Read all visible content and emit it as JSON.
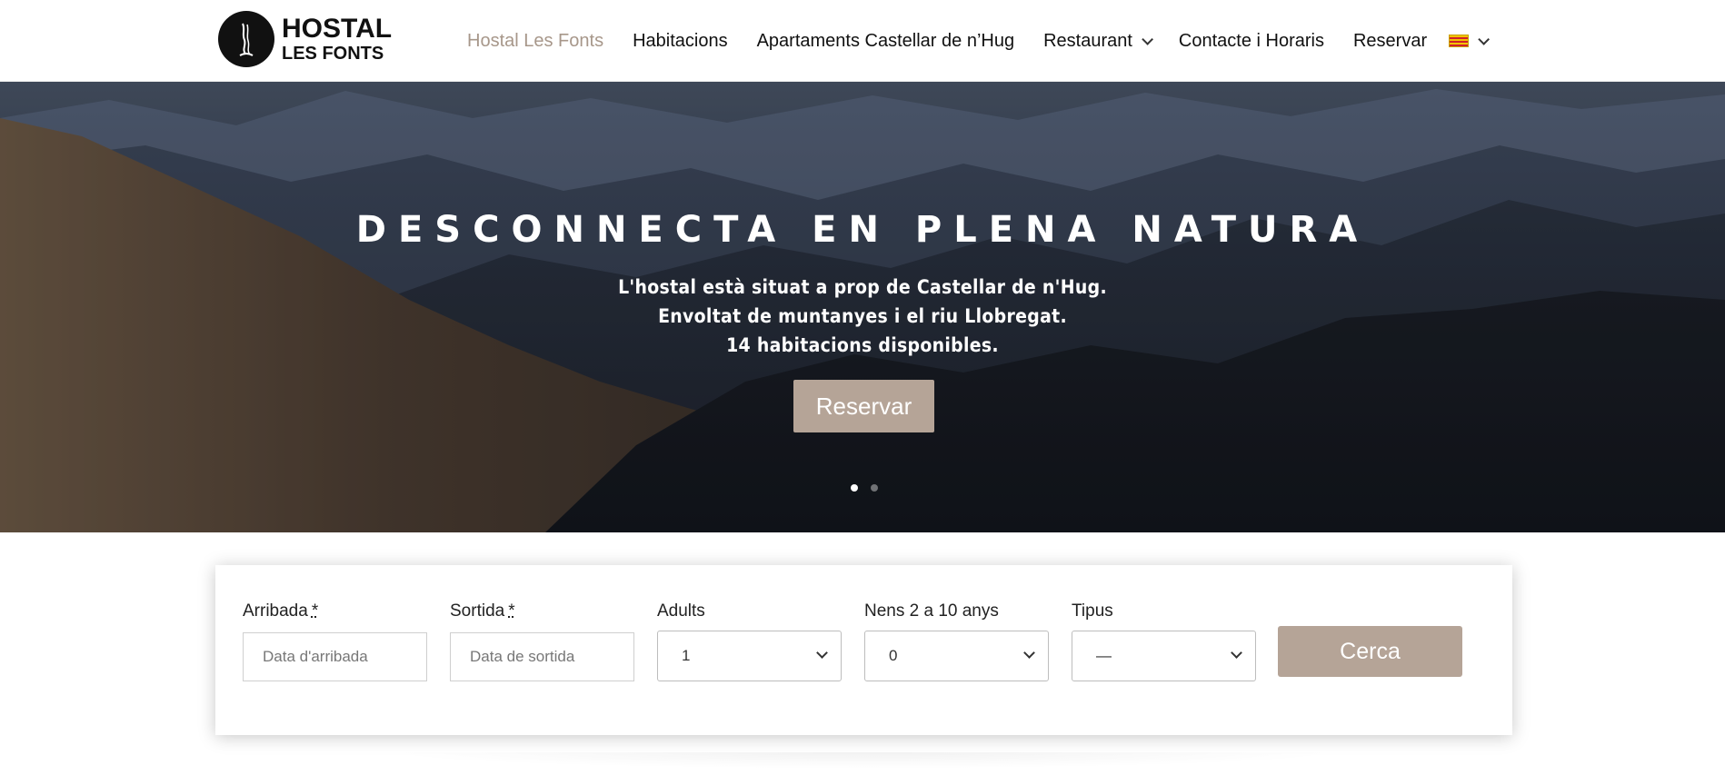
{
  "logo": {
    "line1": "HOSTAL",
    "line2": "LES FONTS",
    "icon": "waterfall-logo-icon"
  },
  "nav": {
    "items": [
      {
        "label": "Hostal Les Fonts",
        "active": true
      },
      {
        "label": "Habitacions"
      },
      {
        "label": "Apartaments Castellar de n’Hug"
      },
      {
        "label": "Restaurant",
        "dropdown": true
      },
      {
        "label": "Contacte i Horaris"
      },
      {
        "label": "Reservar"
      }
    ],
    "language_icon": "catalan-flag-icon"
  },
  "hero": {
    "title": "DESCONNECTA EN PLENA NATURA",
    "lines": [
      "L'hostal està situat a prop de Castellar de n'Hug.",
      "Envoltat de muntanyes i el riu Llobregat.",
      "14 habitacions disponibles."
    ],
    "button": "Reservar",
    "slides": 2,
    "active_slide": 1
  },
  "booking": {
    "arrival_label": "Arribada",
    "arrival_req": "*",
    "arrival_placeholder": "Data d'arribada",
    "departure_label": "Sortida",
    "departure_req": "*",
    "departure_placeholder": "Data de sortida",
    "adults_label": "Adults",
    "adults_value": "1",
    "kids_label": "Nens 2 a 10 anys",
    "kids_value": "0",
    "type_label": "Tipus",
    "type_value": "—",
    "search_button": "Cerca"
  },
  "colors": {
    "accent": "#b5a497",
    "active_nav": "#a7978a"
  }
}
